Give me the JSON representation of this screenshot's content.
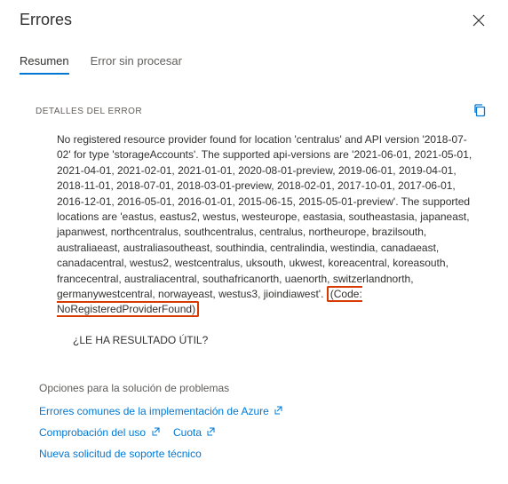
{
  "header": {
    "title": "Errores"
  },
  "tabs": {
    "summary": "Resumen",
    "raw": "Error sin procesar"
  },
  "details": {
    "label": "DETALLES DEL ERROR",
    "message": "No registered resource provider found for location 'centralus' and API version '2018-07-02' for type 'storageAccounts'. The supported api-versions are '2021-06-01, 2021-05-01, 2021-04-01, 2021-02-01, 2021-01-01, 2020-08-01-preview, 2019-06-01, 2019-04-01, 2018-11-01, 2018-07-01, 2018-03-01-preview, 2018-02-01, 2017-10-01, 2017-06-01, 2016-12-01, 2016-05-01, 2016-01-01, 2015-06-15, 2015-05-01-preview'. The supported locations are 'eastus, eastus2, westus, westeurope, eastasia, southeastasia, japaneast, japanwest, northcentralus, southcentralus, centralus, northeurope, brazilsouth, australiaeast, australiasoutheast, southindia, centralindia, westindia, canadaeast, canadacentral, westus2, westcentralus, uksouth, ukwest, koreacentral, koreasouth, francecentral, australiacentral, southafricanorth, uaenorth, switzerlandnorth, germanywestcentral, norwayeast, westus3, jioindiawest'. ",
    "code_highlight": "(Code: NoRegisteredProviderFound)"
  },
  "feedback": {
    "prompt": "¿LE HA RESULTADO ÚTIL?"
  },
  "troubleshoot": {
    "title": "Opciones para la solución de problemas",
    "link_common": "Errores comunes de la implementación de Azure",
    "link_check": "Comprobación del uso",
    "link_quota": "Cuota",
    "link_new": "Nueva solicitud de soporte técnico"
  }
}
